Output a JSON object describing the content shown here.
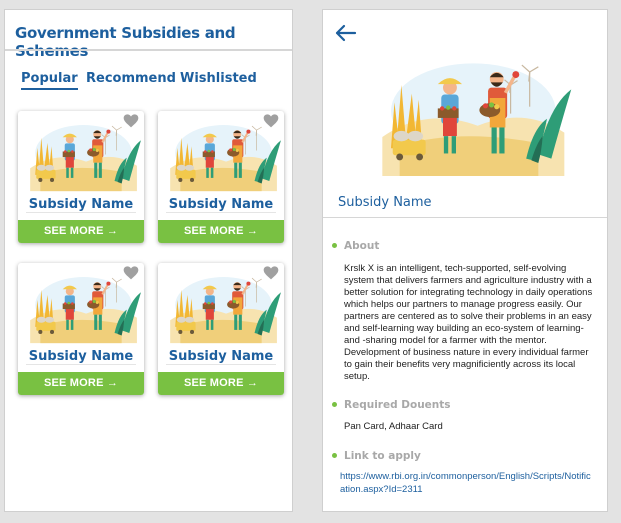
{
  "list_screen": {
    "title": "Government Subsidies and Schemes",
    "tabs": [
      {
        "label": "Popular",
        "active": true
      },
      {
        "label": "Recommend",
        "active": false
      },
      {
        "label": "Wishlisted",
        "active": false
      }
    ],
    "cards": [
      {
        "name": "Subsidy Name",
        "button": "SEE MORE →",
        "favorite_icon": "heart-icon"
      },
      {
        "name": "Subsidy Name",
        "button": "SEE MORE →",
        "favorite_icon": "heart-icon"
      },
      {
        "name": "Subsidy Name",
        "button": "SEE MORE →",
        "favorite_icon": "heart-icon"
      },
      {
        "name": "Subsidy Name",
        "button": "SEE MORE →",
        "favorite_icon": "heart-icon"
      }
    ]
  },
  "detail_screen": {
    "back_icon": "back-arrow-icon",
    "name": "Subsidy Name",
    "about_title": "About",
    "about_text": "Krslk X is an intelligent,  tech-supported, self-evolving system that delivers farmers and agriculture industry with a better solution for integrating technology in daily operations which helps our partners to manage progress easily. Our partners are centered as to solve their problems in an easy and self-learning way building an eco-system of learning-and -sharing model for a farmer with the mentor. Development of business nature in every individual farmer to gain their benefits very magnificiently across its local setup.",
    "docs_title": "Required Douents",
    "docs_text": "Pan Card, Adhaar Card",
    "link_title": "Link to apply",
    "link_url": "https://www.rbi.org.in/commonperson/English/Scripts/Notification.aspx?Id=2311"
  },
  "colors": {
    "brand_blue": "#1d5f9e",
    "accent_green": "#79c142",
    "heart_gray": "#a0a0a0",
    "section_title_gray": "#a8a8a8"
  }
}
